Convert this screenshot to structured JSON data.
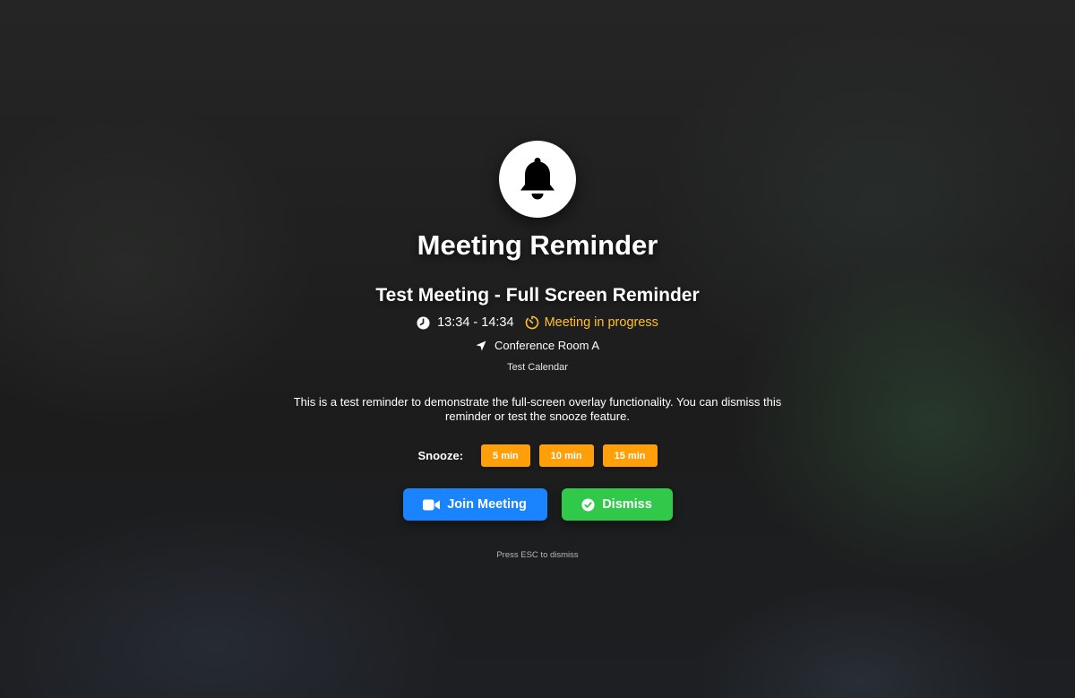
{
  "overlay": {
    "icon": "bell-icon",
    "title": "Meeting Reminder"
  },
  "meeting": {
    "name": "Test Meeting - Full Screen Reminder",
    "time_icon": "clock-icon",
    "time_range": "13:34 - 14:34",
    "status_icon": "timer-icon",
    "status": "Meeting in progress",
    "location_icon": "location-arrow-icon",
    "location": "Conference Room A",
    "calendar": "Test Calendar",
    "description": "This is a test reminder to demonstrate the full-screen overlay functionality. You can dismiss this reminder or test the snooze feature."
  },
  "snooze": {
    "label": "Snooze:",
    "options": [
      "5 min",
      "10 min",
      "15 min"
    ]
  },
  "actions": {
    "join_icon": "video-camera-icon",
    "join_label": "Join Meeting",
    "dismiss_icon": "check-circle-icon",
    "dismiss_label": "Dismiss"
  },
  "hint": "Press ESC to dismiss",
  "colors": {
    "status_accent": "#ffc02a",
    "snooze_button": "#ff9f0a",
    "join_button": "#1a84ff",
    "dismiss_button": "#30c94a"
  }
}
